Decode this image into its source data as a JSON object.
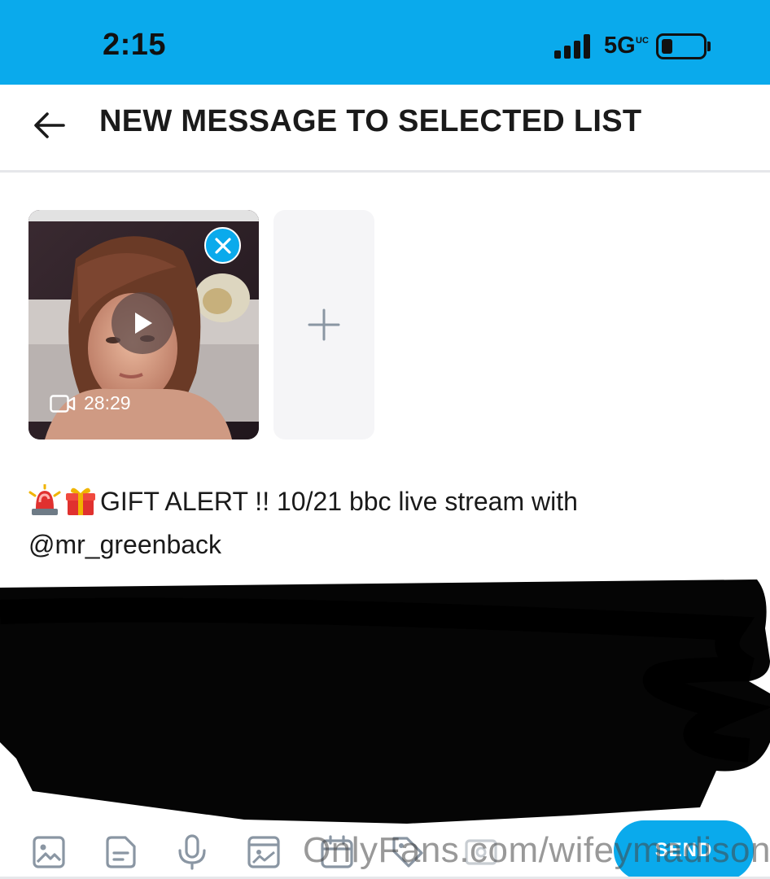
{
  "status_bar": {
    "time": "2:15",
    "network": "5G",
    "network_badge": "UC",
    "background_color": "#0aaaec"
  },
  "header": {
    "title": "NEW MESSAGE TO SELECTED LIST",
    "back_icon": "arrow-left-icon"
  },
  "media": {
    "attachments": [
      {
        "type": "video",
        "duration": "28:29",
        "icons": [
          "close-icon",
          "play-icon",
          "video-camera-icon"
        ]
      }
    ],
    "add_icon": "plus-icon"
  },
  "message": {
    "emojis": [
      "police-light-emoji",
      "gift-emoji"
    ],
    "line1": "GIFT ALERT !! 10/21 bbc live stream with",
    "line2": "@mr_greenback"
  },
  "toolbar": {
    "tools": [
      "image-icon",
      "document-icon",
      "microphone-icon",
      "vault-icon",
      "calendar-icon",
      "tag-icon",
      "price-icon"
    ],
    "send_label": "SEND",
    "accent_color": "#0aaaec"
  },
  "watermark": "OnlyFans.com/wifeymadison"
}
